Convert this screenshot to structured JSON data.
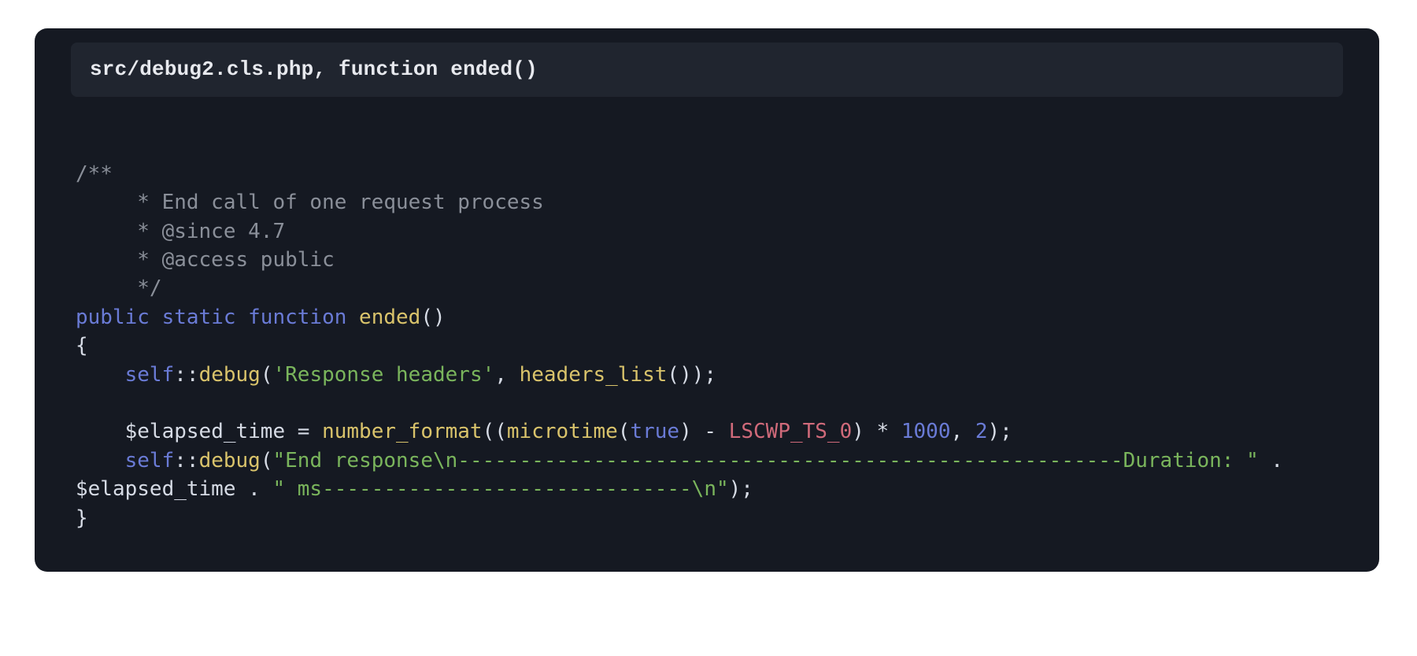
{
  "title": "src/debug2.cls.php, function ended()",
  "code": {
    "comment": {
      "open": "/**",
      "l1": "     * End call of one request process",
      "l2": "     * @since 4.7",
      "l3": "     * @access public",
      "close": "     */"
    },
    "kw_public": "public",
    "kw_static": "static",
    "kw_function": "function",
    "fn_name": "ended",
    "brace_open": "{",
    "brace_close": "}",
    "self": "self",
    "debug": "debug",
    "str_headers": "'Response headers'",
    "headers_list": "headers_list",
    "var_elapsed": "$elapsed_time",
    "eq": " = ",
    "number_format": "number_format",
    "microtime": "microtime",
    "true": "true",
    "const_ts": "LSCWP_TS_0",
    "minus": " - ",
    "times": " * ",
    "n1000": "1000",
    "comma_sp": ", ",
    "n2": "2",
    "str_end_a": "\"End response\\n------------------------------------------------------Duration: \"",
    "dot_sp": " . ",
    "str_end_b": "\" ms------------------------------\\n\""
  }
}
